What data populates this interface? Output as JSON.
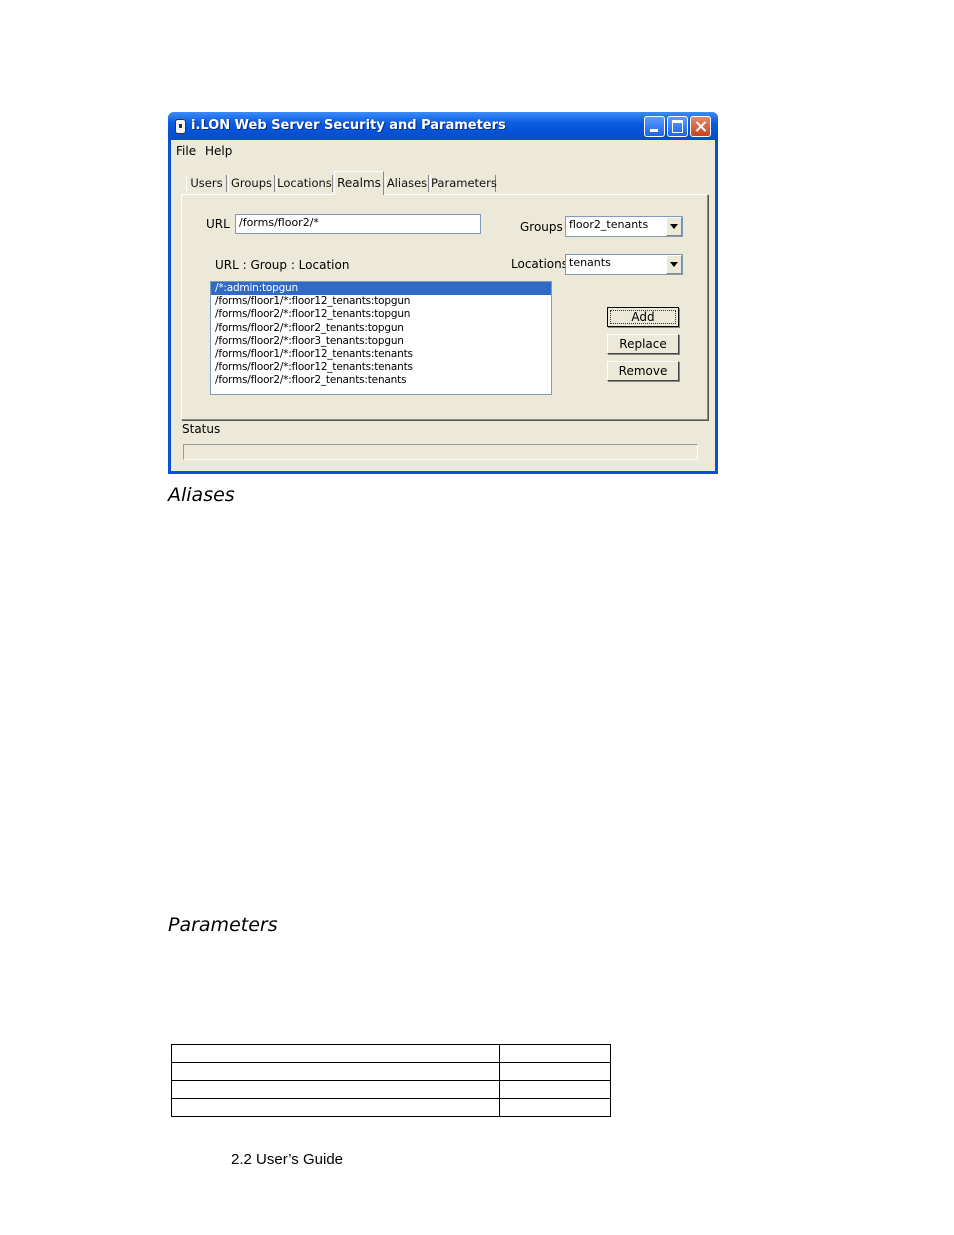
{
  "window": {
    "title": "i.LON Web Server Security and Parameters",
    "menu": [
      "File",
      "Help"
    ],
    "tabs": [
      "Users",
      "Groups",
      "Locations",
      "Realms",
      "Aliases",
      "Parameters"
    ],
    "active_tab": "Realms"
  },
  "realms": {
    "url_label": "URL",
    "url_value": "/forms/floor2/*",
    "groups_label": "Groups",
    "groups_value": "floor2_tenants",
    "locations_label": "Locations",
    "locations_value": "tenants",
    "list_header": "URL : Group : Location",
    "list_items": [
      "/*:admin:topgun",
      "/forms/floor1/*:floor12_tenants:topgun",
      "/forms/floor2/*:floor12_tenants:topgun",
      "/forms/floor2/*:floor2_tenants:topgun",
      "/forms/floor2/*:floor3_tenants:topgun",
      "/forms/floor1/*:floor12_tenants:tenants",
      "/forms/floor2/*:floor12_tenants:tenants",
      "/forms/floor2/*:floor2_tenants:tenants"
    ],
    "buttons": {
      "add": "Add",
      "replace": "Replace",
      "remove": "Remove"
    },
    "status_label": "Status"
  },
  "document": {
    "heading_aliases": "Aliases",
    "heading_parameters": "Parameters",
    "footer": "2.2 User’s Guide"
  }
}
